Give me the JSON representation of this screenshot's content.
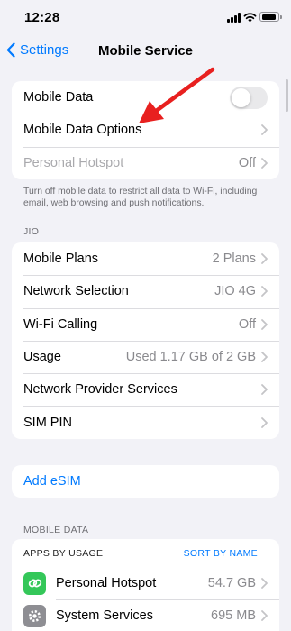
{
  "status_bar": {
    "time": "12:28"
  },
  "nav": {
    "back_label": "Settings",
    "title": "Mobile Service"
  },
  "group_main": {
    "mobile_data_label": "Mobile Data",
    "mobile_data_on": false,
    "mobile_data_options_label": "Mobile Data Options",
    "personal_hotspot_label": "Personal Hotspot",
    "personal_hotspot_value": "Off"
  },
  "footnote": "Turn off mobile data to restrict all data to Wi-Fi, including email, web browsing and push notifications.",
  "carrier": {
    "header": "JIO",
    "rows": [
      {
        "label": "Mobile Plans",
        "value": "2 Plans"
      },
      {
        "label": "Network Selection",
        "value": "JIO 4G"
      },
      {
        "label": "Wi-Fi Calling",
        "value": "Off"
      },
      {
        "label": "Usage",
        "value": "Used 1.17 GB of 2 GB"
      },
      {
        "label": "Network Provider Services",
        "value": ""
      },
      {
        "label": "SIM PIN",
        "value": ""
      }
    ]
  },
  "esim": {
    "label": "Add eSIM"
  },
  "mobile_data_section": {
    "header": "MOBILE DATA",
    "apps_by_usage": "APPS BY USAGE",
    "sort_by_name": "SORT BY NAME",
    "apps": [
      {
        "name": "Personal Hotspot",
        "value": "54.7 GB",
        "icon": "link-icon",
        "icon_color": "#34c759"
      },
      {
        "name": "System Services",
        "value": "695 MB",
        "icon": "gear-icon",
        "icon_color": "#8e8e93"
      }
    ]
  },
  "colors": {
    "accent": "#007aff",
    "background": "#f2f2f7",
    "annotation_arrow": "#e8201f"
  }
}
